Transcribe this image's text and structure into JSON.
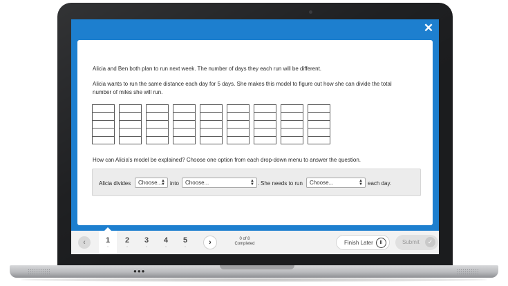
{
  "question": {
    "line1": "Alicia and Ben both plan to run next week. The number of days they each run will be different.",
    "line2": "Alicia wants to run the same distance each day for 5 days. She makes this model to figure out how she can divide the total number of miles she will run.",
    "line3": "How can Alicia's model be explained? Choose one option from each drop-down menu to answer the question.",
    "model_blocks": 9,
    "rows_per_block": 5
  },
  "answer": {
    "part1": "Alicia divides",
    "part2": "into",
    "part3": "She needs to run",
    "part4": "each day.",
    "dropdown1": "Choose...",
    "dropdown2": "Choose...",
    "dropdown3": "Choose..."
  },
  "nav": {
    "prev_icon": "chevron-left-icon",
    "next_icon": "chevron-right-icon",
    "questions": [
      "1",
      "2",
      "3",
      "4",
      "5"
    ],
    "current_question": "1",
    "progress_count": "0 of 8",
    "progress_label": "Completed",
    "finish_later": "Finish Later",
    "submit": "Submit"
  },
  "colors": {
    "screen_blue": "#1d7fcf",
    "bezel": "#1b1c1e"
  }
}
